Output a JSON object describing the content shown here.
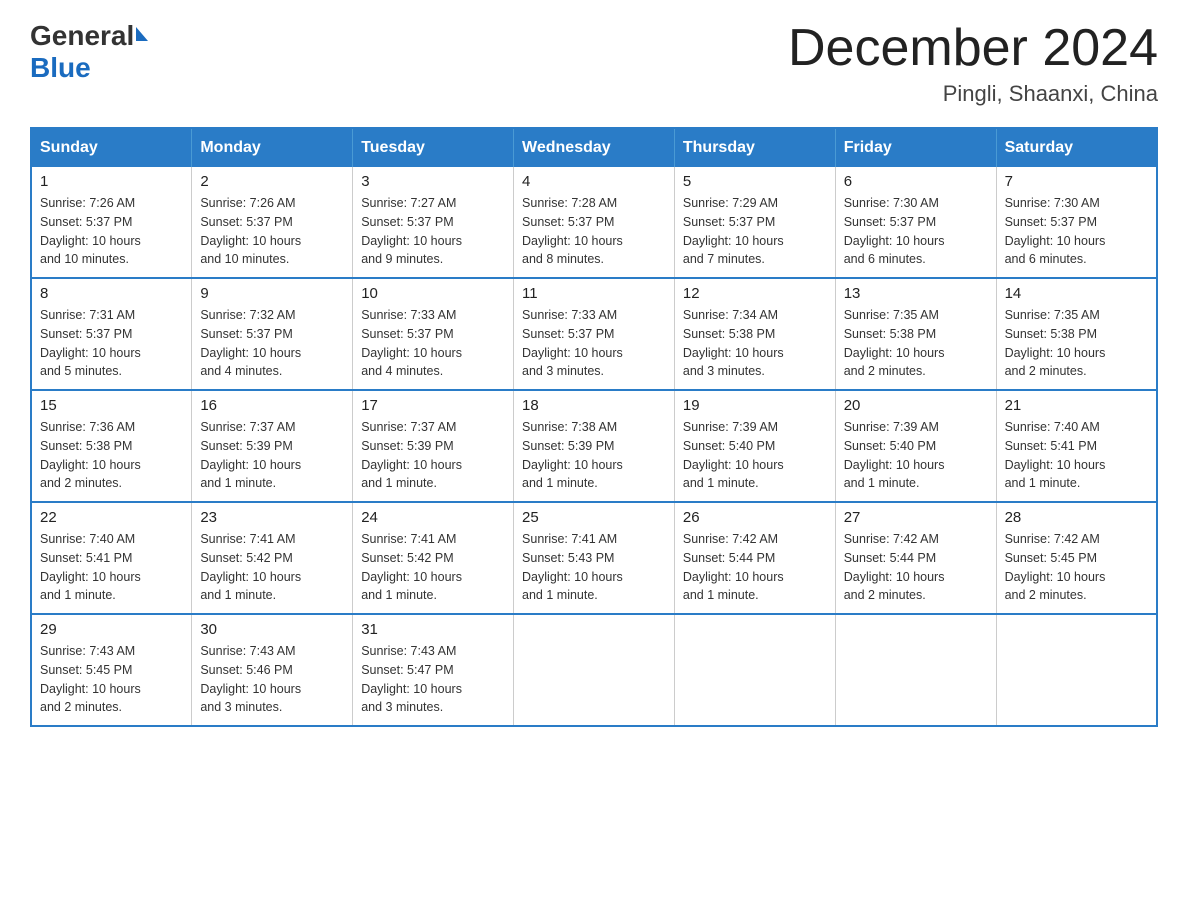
{
  "header": {
    "logo": {
      "general": "General",
      "blue": "Blue"
    },
    "title": "December 2024",
    "location": "Pingli, Shaanxi, China"
  },
  "calendar": {
    "days_of_week": [
      "Sunday",
      "Monday",
      "Tuesday",
      "Wednesday",
      "Thursday",
      "Friday",
      "Saturday"
    ],
    "weeks": [
      [
        {
          "day": "1",
          "sunrise": "7:26 AM",
          "sunset": "5:37 PM",
          "daylight": "10 hours and 10 minutes."
        },
        {
          "day": "2",
          "sunrise": "7:26 AM",
          "sunset": "5:37 PM",
          "daylight": "10 hours and 10 minutes."
        },
        {
          "day": "3",
          "sunrise": "7:27 AM",
          "sunset": "5:37 PM",
          "daylight": "10 hours and 9 minutes."
        },
        {
          "day": "4",
          "sunrise": "7:28 AM",
          "sunset": "5:37 PM",
          "daylight": "10 hours and 8 minutes."
        },
        {
          "day": "5",
          "sunrise": "7:29 AM",
          "sunset": "5:37 PM",
          "daylight": "10 hours and 7 minutes."
        },
        {
          "day": "6",
          "sunrise": "7:30 AM",
          "sunset": "5:37 PM",
          "daylight": "10 hours and 6 minutes."
        },
        {
          "day": "7",
          "sunrise": "7:30 AM",
          "sunset": "5:37 PM",
          "daylight": "10 hours and 6 minutes."
        }
      ],
      [
        {
          "day": "8",
          "sunrise": "7:31 AM",
          "sunset": "5:37 PM",
          "daylight": "10 hours and 5 minutes."
        },
        {
          "day": "9",
          "sunrise": "7:32 AM",
          "sunset": "5:37 PM",
          "daylight": "10 hours and 4 minutes."
        },
        {
          "day": "10",
          "sunrise": "7:33 AM",
          "sunset": "5:37 PM",
          "daylight": "10 hours and 4 minutes."
        },
        {
          "day": "11",
          "sunrise": "7:33 AM",
          "sunset": "5:37 PM",
          "daylight": "10 hours and 3 minutes."
        },
        {
          "day": "12",
          "sunrise": "7:34 AM",
          "sunset": "5:38 PM",
          "daylight": "10 hours and 3 minutes."
        },
        {
          "day": "13",
          "sunrise": "7:35 AM",
          "sunset": "5:38 PM",
          "daylight": "10 hours and 2 minutes."
        },
        {
          "day": "14",
          "sunrise": "7:35 AM",
          "sunset": "5:38 PM",
          "daylight": "10 hours and 2 minutes."
        }
      ],
      [
        {
          "day": "15",
          "sunrise": "7:36 AM",
          "sunset": "5:38 PM",
          "daylight": "10 hours and 2 minutes."
        },
        {
          "day": "16",
          "sunrise": "7:37 AM",
          "sunset": "5:39 PM",
          "daylight": "10 hours and 1 minute."
        },
        {
          "day": "17",
          "sunrise": "7:37 AM",
          "sunset": "5:39 PM",
          "daylight": "10 hours and 1 minute."
        },
        {
          "day": "18",
          "sunrise": "7:38 AM",
          "sunset": "5:39 PM",
          "daylight": "10 hours and 1 minute."
        },
        {
          "day": "19",
          "sunrise": "7:39 AM",
          "sunset": "5:40 PM",
          "daylight": "10 hours and 1 minute."
        },
        {
          "day": "20",
          "sunrise": "7:39 AM",
          "sunset": "5:40 PM",
          "daylight": "10 hours and 1 minute."
        },
        {
          "day": "21",
          "sunrise": "7:40 AM",
          "sunset": "5:41 PM",
          "daylight": "10 hours and 1 minute."
        }
      ],
      [
        {
          "day": "22",
          "sunrise": "7:40 AM",
          "sunset": "5:41 PM",
          "daylight": "10 hours and 1 minute."
        },
        {
          "day": "23",
          "sunrise": "7:41 AM",
          "sunset": "5:42 PM",
          "daylight": "10 hours and 1 minute."
        },
        {
          "day": "24",
          "sunrise": "7:41 AM",
          "sunset": "5:42 PM",
          "daylight": "10 hours and 1 minute."
        },
        {
          "day": "25",
          "sunrise": "7:41 AM",
          "sunset": "5:43 PM",
          "daylight": "10 hours and 1 minute."
        },
        {
          "day": "26",
          "sunrise": "7:42 AM",
          "sunset": "5:44 PM",
          "daylight": "10 hours and 1 minute."
        },
        {
          "day": "27",
          "sunrise": "7:42 AM",
          "sunset": "5:44 PM",
          "daylight": "10 hours and 2 minutes."
        },
        {
          "day": "28",
          "sunrise": "7:42 AM",
          "sunset": "5:45 PM",
          "daylight": "10 hours and 2 minutes."
        }
      ],
      [
        {
          "day": "29",
          "sunrise": "7:43 AM",
          "sunset": "5:45 PM",
          "daylight": "10 hours and 2 minutes."
        },
        {
          "day": "30",
          "sunrise": "7:43 AM",
          "sunset": "5:46 PM",
          "daylight": "10 hours and 3 minutes."
        },
        {
          "day": "31",
          "sunrise": "7:43 AM",
          "sunset": "5:47 PM",
          "daylight": "10 hours and 3 minutes."
        },
        null,
        null,
        null,
        null
      ]
    ],
    "labels": {
      "sunrise": "Sunrise:",
      "sunset": "Sunset:",
      "daylight": "Daylight:"
    }
  }
}
